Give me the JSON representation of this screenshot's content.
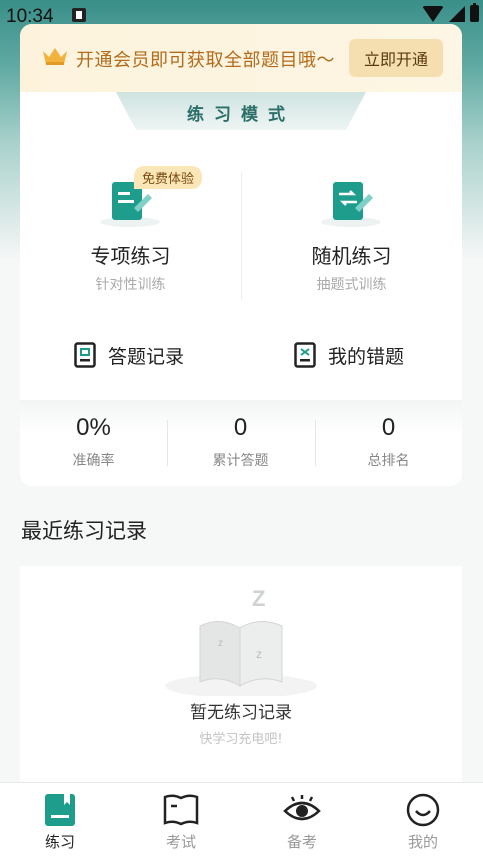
{
  "status_bar": {
    "time": "10:34"
  },
  "vip": {
    "text": "开通会员即可获取全部题目哦～",
    "button": "立即开通"
  },
  "mode": {
    "title": "练习模式",
    "items": [
      {
        "title": "专项练习",
        "subtitle": "针对性训练",
        "badge": "免费体验"
      },
      {
        "title": "随机练习",
        "subtitle": "抽题式训练"
      }
    ]
  },
  "records": {
    "answer_record": "答题记录",
    "wrong_questions": "我的错题"
  },
  "stats": [
    {
      "value": "0%",
      "label": "准确率"
    },
    {
      "value": "0",
      "label": "累计答题"
    },
    {
      "value": "0",
      "label": "总排名"
    }
  ],
  "recent": {
    "title": "最近练习记录",
    "empty_title": "暂无练习记录",
    "empty_subtitle": "快学习充电吧!"
  },
  "nav": [
    {
      "label": "练习",
      "icon": "practice-icon",
      "active": true
    },
    {
      "label": "考试",
      "icon": "exam-book-icon",
      "active": false
    },
    {
      "label": "备考",
      "icon": "eye-icon",
      "active": false
    },
    {
      "label": "我的",
      "icon": "smile-face-icon",
      "active": false
    }
  ],
  "colors": {
    "primary": "#1f9d8c",
    "gold": "#b36b1a",
    "vip_bg": "#fdf3dd"
  }
}
